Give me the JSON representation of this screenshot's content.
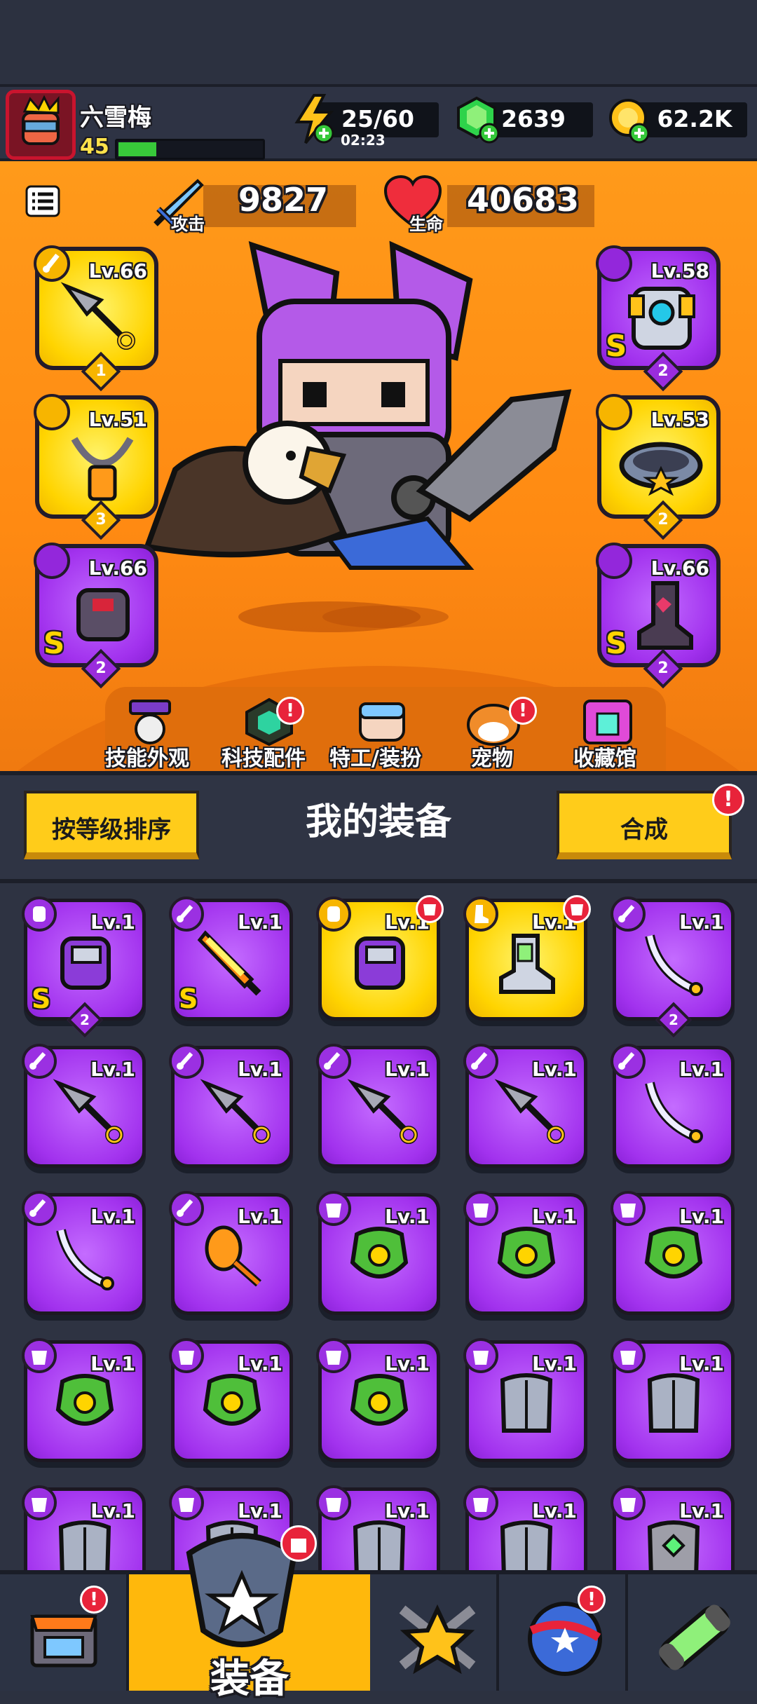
{
  "player": {
    "name": "六雪梅",
    "level": "45",
    "xp_fraction": 0.26
  },
  "resources": {
    "energy": "25/60",
    "energy_timer": "02:23",
    "gems": "2639",
    "gold": "62.2K"
  },
  "stats": {
    "attack_label": "攻击",
    "attack_value": "9827",
    "hp_label": "生命",
    "hp_value": "40683"
  },
  "equipped": {
    "weapon": {
      "level": "Lv.66",
      "count": "1",
      "rarity": "gold",
      "icon": "kunai-icon"
    },
    "necklace": {
      "level": "Lv.51",
      "count": "3",
      "rarity": "gold",
      "icon": "necklace-icon"
    },
    "gloves": {
      "level": "Lv.66",
      "count": "2",
      "rarity": "purple",
      "grade": "S",
      "icon": "gauntlet-icon"
    },
    "armor": {
      "level": "Lv.58",
      "count": "2",
      "rarity": "purple",
      "grade": "S",
      "icon": "mech-armor-icon"
    },
    "belt": {
      "level": "Lv.53",
      "count": "2",
      "rarity": "gold",
      "icon": "belt-icon"
    },
    "boots": {
      "level": "Lv.66",
      "count": "2",
      "rarity": "purple",
      "grade": "S",
      "icon": "boots-icon"
    }
  },
  "menu": [
    {
      "label": "技能外观",
      "icon": "skill-skin-icon",
      "alert": false
    },
    {
      "label": "科技配件",
      "icon": "tech-part-icon",
      "alert": true
    },
    {
      "label": "特工/装扮",
      "icon": "agent-icon",
      "alert": false
    },
    {
      "label": "宠物",
      "icon": "pet-icon",
      "alert": true
    },
    {
      "label": "收藏馆",
      "icon": "collection-icon",
      "alert": false
    }
  ],
  "section": {
    "sort_button": "按等级排序",
    "title": "我的装备",
    "merge_button": "合成",
    "alert": "!"
  },
  "inventory": [
    {
      "level": "Lv.1",
      "rarity": "purple",
      "slot": "glove",
      "grade": "S",
      "count": "2",
      "icon": "gauntlet-icon"
    },
    {
      "level": "Lv.1",
      "rarity": "purple",
      "slot": "weapon",
      "grade": "S",
      "icon": "flame-sword-icon"
    },
    {
      "level": "Lv.1",
      "rarity": "gold",
      "slot": "glove",
      "new": true,
      "icon": "gauntlet-icon"
    },
    {
      "level": "Lv.1",
      "rarity": "gold",
      "slot": "boots",
      "new": true,
      "icon": "boots-icon"
    },
    {
      "level": "Lv.1",
      "rarity": "purple",
      "slot": "weapon",
      "count": "2",
      "icon": "katana-icon"
    },
    {
      "level": "Lv.1",
      "rarity": "purple",
      "slot": "weapon",
      "icon": "kunai-icon"
    },
    {
      "level": "Lv.1",
      "rarity": "purple",
      "slot": "weapon",
      "icon": "kunai-icon"
    },
    {
      "level": "Lv.1",
      "rarity": "purple",
      "slot": "weapon",
      "icon": "kunai-icon"
    },
    {
      "level": "Lv.1",
      "rarity": "purple",
      "slot": "weapon",
      "icon": "kunai-icon"
    },
    {
      "level": "Lv.1",
      "rarity": "purple",
      "slot": "weapon",
      "icon": "katana-icon"
    },
    {
      "level": "Lv.1",
      "rarity": "purple",
      "slot": "weapon",
      "icon": "katana-icon"
    },
    {
      "level": "Lv.1",
      "rarity": "purple",
      "slot": "weapon",
      "icon": "torch-icon"
    },
    {
      "level": "Lv.1",
      "rarity": "purple",
      "slot": "armor",
      "icon": "green-armor-icon"
    },
    {
      "level": "Lv.1",
      "rarity": "purple",
      "slot": "armor",
      "icon": "green-armor-icon"
    },
    {
      "level": "Lv.1",
      "rarity": "purple",
      "slot": "armor",
      "icon": "green-armor-icon"
    },
    {
      "level": "Lv.1",
      "rarity": "purple",
      "slot": "armor",
      "icon": "green-armor-icon"
    },
    {
      "level": "Lv.1",
      "rarity": "purple",
      "slot": "armor",
      "icon": "green-armor-icon"
    },
    {
      "level": "Lv.1",
      "rarity": "purple",
      "slot": "armor",
      "icon": "green-armor-icon"
    },
    {
      "level": "Lv.1",
      "rarity": "purple",
      "slot": "armor",
      "icon": "steel-armor-icon"
    },
    {
      "level": "Lv.1",
      "rarity": "purple",
      "slot": "armor",
      "icon": "steel-armor-icon"
    },
    {
      "level": "Lv.1",
      "rarity": "purple",
      "slot": "armor",
      "icon": "steel-armor-icon"
    },
    {
      "level": "Lv.1",
      "rarity": "purple",
      "slot": "armor",
      "icon": "steel-armor-icon"
    },
    {
      "level": "Lv.1",
      "rarity": "purple",
      "slot": "armor",
      "icon": "steel-armor-icon"
    },
    {
      "level": "Lv.1",
      "rarity": "purple",
      "slot": "armor",
      "icon": "steel-armor-icon"
    },
    {
      "level": "Lv.1",
      "rarity": "purple",
      "slot": "armor",
      "icon": "gem-armor-icon"
    }
  ],
  "bottom_nav": {
    "shop": {
      "icon": "shop-icon",
      "alert": "!"
    },
    "equipment": {
      "label": "装备",
      "icon": "equipment-icon",
      "alert": true
    },
    "battle": {
      "icon": "battle-star-icon"
    },
    "events": {
      "icon": "globe-stars-icon",
      "alert": "!"
    },
    "evolve": {
      "icon": "dna-capsule-icon"
    }
  },
  "colors": {
    "gold_rarity": "#ffd400",
    "purple_rarity": "#a232ee",
    "accent": "#ffb80c",
    "alert": "#e8233a"
  }
}
